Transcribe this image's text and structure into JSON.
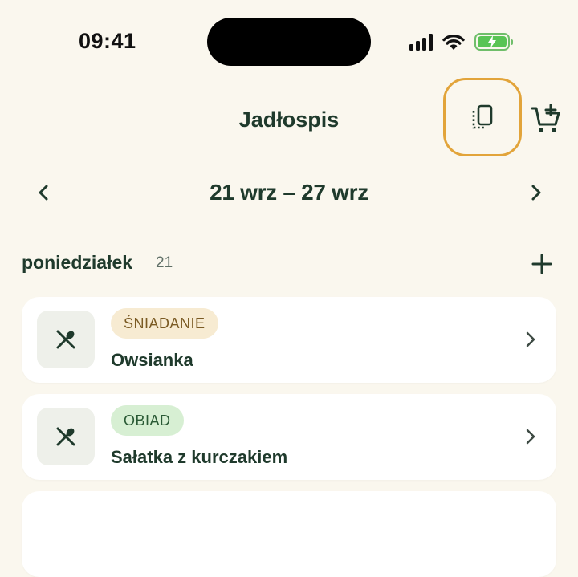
{
  "status_bar": {
    "time": "09:41"
  },
  "header": {
    "title": "Jadłospis"
  },
  "week_nav": {
    "range": "21 wrz – 27 wrz"
  },
  "day": {
    "name": "poniedziałek",
    "number": "21"
  },
  "meals": [
    {
      "tag": "ŚNIADANIE",
      "name": "Owsianka"
    },
    {
      "tag": "OBIAD",
      "name": "Sałatka z kurczakiem"
    }
  ],
  "colors": {
    "background": "#faf7ee",
    "text_primary": "#1f3a2c",
    "highlight_ring": "#e2a43a",
    "tag_breakfast_bg": "#f7ebd2",
    "tag_lunch_bg": "#d7efd3",
    "battery": "#59c455"
  },
  "icons": {
    "copy": "copy-week-icon",
    "cart": "add-to-cart-icon",
    "prev": "chevron-left-icon",
    "next": "chevron-right-icon",
    "add": "plus-icon",
    "meal": "fork-spoon-icon"
  }
}
